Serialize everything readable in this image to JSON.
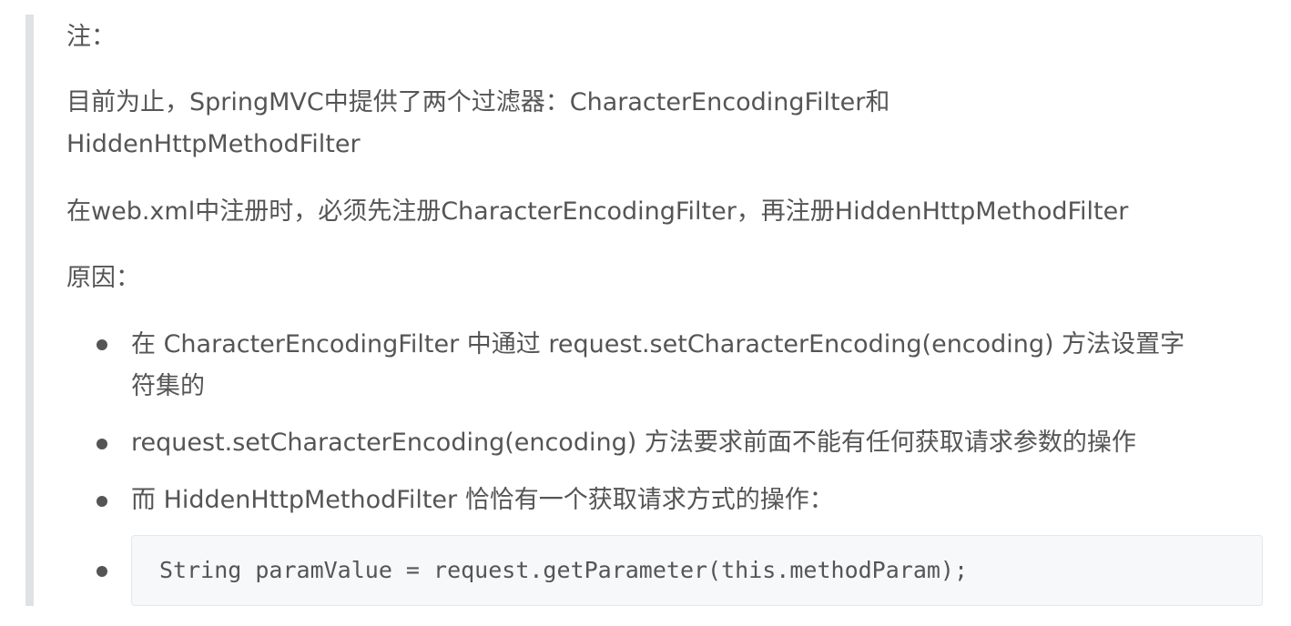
{
  "note_label": "注：",
  "paragraph1_line1": "目前为止，SpringMVC中提供了两个过滤器：CharacterEncodingFilter和",
  "paragraph1_line2": "HiddenHttpMethodFilter",
  "paragraph2": "在web.xml中注册时，必须先注册CharacterEncodingFilter，再注册HiddenHttpMethodFilter",
  "reason_label": "原因：",
  "list": {
    "item1_line1": "在 CharacterEncodingFilter 中通过 request.setCharacterEncoding(encoding) 方法设置字",
    "item1_line2": "符集的",
    "item2": "request.setCharacterEncoding(encoding) 方法要求前面不能有任何获取请求参数的操作",
    "item3": "而 HiddenHttpMethodFilter 恰恰有一个获取请求方式的操作：",
    "code": "String paramValue = request.getParameter(this.methodParam);"
  }
}
